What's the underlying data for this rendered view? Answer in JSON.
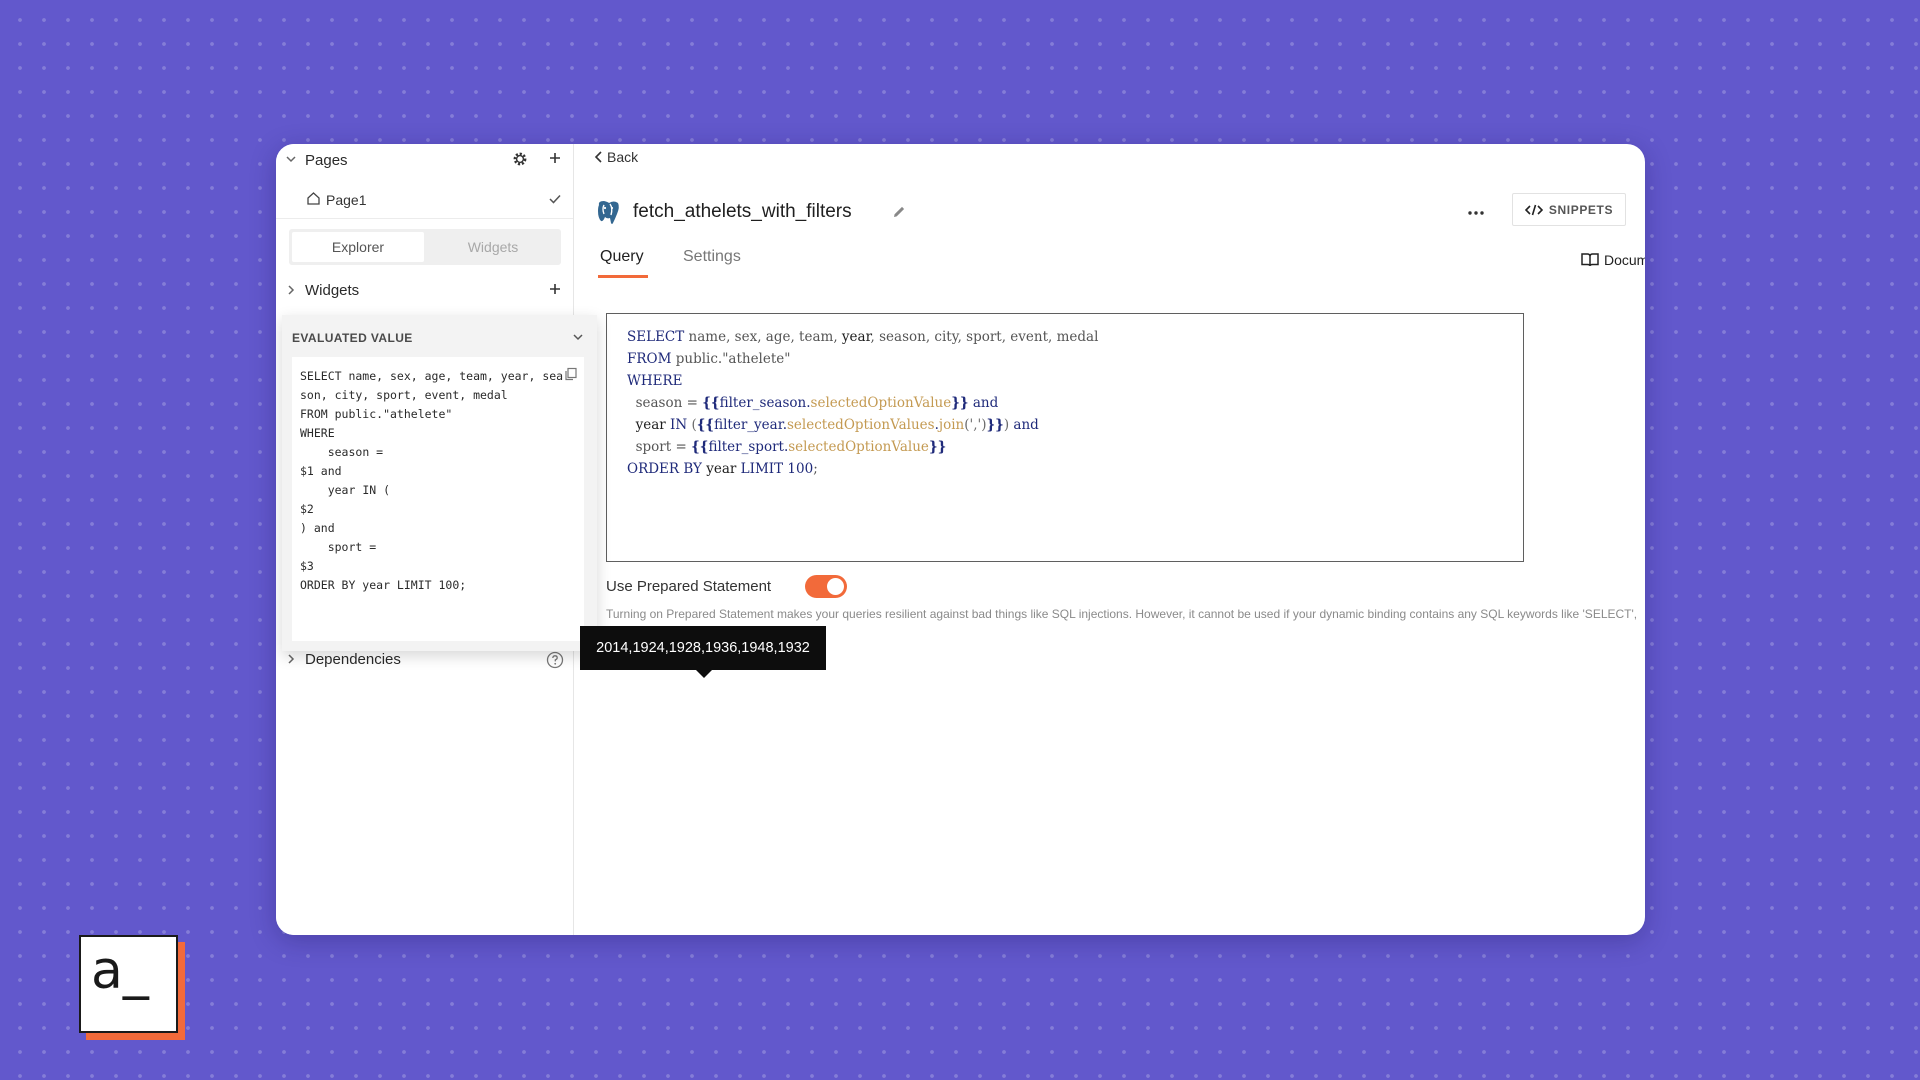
{
  "sidebar": {
    "pages_label": "Pages",
    "page1_label": "Page1",
    "explorer_tab": "Explorer",
    "widgets_tab": "Widgets",
    "widgets_section": "Widgets",
    "evaluated_header": "EVALUATED VALUE",
    "evaluated_code": "SELECT name, sex, age, team, year, season, city, sport, event, medal\nFROM public.\"athelete\"\nWHERE\n    season =\n$1 and\n    year IN (\n$2\n) and\n    sport =\n$3\nORDER BY year LIMIT 100;",
    "dependencies_label": "Dependencies",
    "tooltip": "2014,1924,1928,1936,1948,1932"
  },
  "main": {
    "back_label": "Back",
    "query_name": "fetch_athelets_with_filters",
    "snippets_label": "SNIPPETS",
    "tab_query": "Query",
    "tab_settings": "Settings",
    "docs_label": "Documen",
    "prepared_label": "Use Prepared Statement",
    "prepared_enabled": true,
    "prepared_desc": "Turning on Prepared Statement makes your queries resilient against bad things like SQL injections. However, it cannot be used if your dynamic binding contains any SQL keywords like 'SELECT', 'WHERE', 'AND', etc."
  },
  "editor": {
    "l1_kw": "SELECT",
    "l1_a": " name, sex, age, team, ",
    "l1_b": "year",
    "l1_c": ", season, city, sport, event, medal",
    "l2_kw": "FROM",
    "l2_rest": " public.\"athelete\"",
    "l3_kw": "WHERE",
    "l4_a": "  season = ",
    "l4_ob": "{{",
    "l4_obj": "filter_season",
    "l4_dot": ".",
    "l4_prop": "selectedOptionValue",
    "l4_cb": "}}",
    "l4_and": " and",
    "l5_a": "  ",
    "l5_year": "year",
    "l5_in": " IN ",
    "l5_paren": "(",
    "l5_ob": "{{",
    "l5_obj": "filter_year",
    "l5_dot": ".",
    "l5_prop": "selectedOptionValues",
    "l5_dot2": ".",
    "l5_fn": "join",
    "l5_args": "(',')",
    "l5_cb": "}}",
    "l5_paren2": ")",
    "l5_and": " and",
    "l6_a": "  sport = ",
    "l6_ob": "{{",
    "l6_obj": "filter_sport",
    "l6_dot": ".",
    "l6_prop": "selectedOptionValue",
    "l6_cb": "}}",
    "l7_kw": "ORDER BY",
    "l7_year": " year",
    "l7_limit": " LIMIT",
    "l7_num": " 100",
    "l7_end": ";"
  },
  "brand": {
    "logo_text": "a_",
    "accent": "#f26a3a",
    "background": "#6258cc"
  }
}
